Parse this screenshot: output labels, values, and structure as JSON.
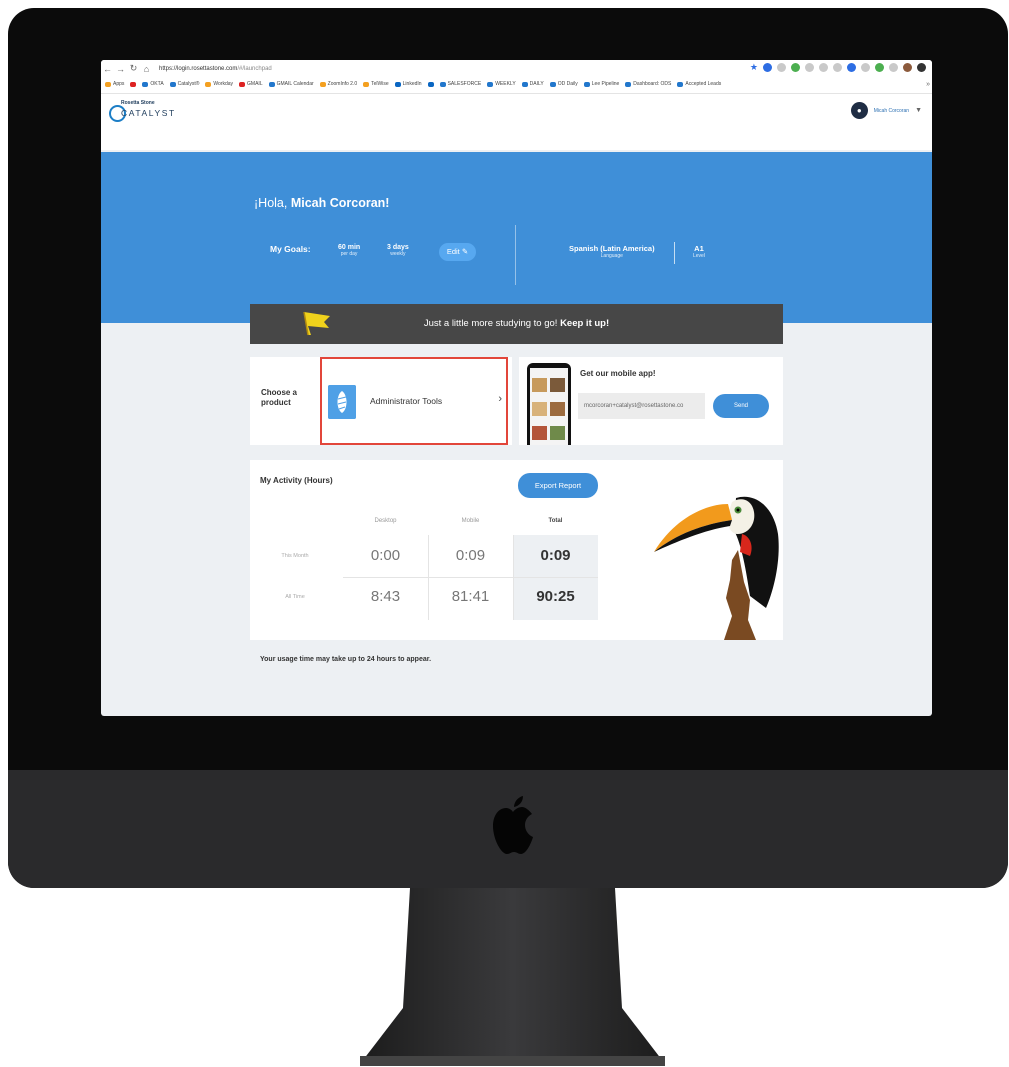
{
  "browser": {
    "url_host": "https://login.rosettastone.com",
    "url_path": "/#/launchpad",
    "bookmarks": [
      "Apps",
      "OKTA",
      "Catalyst®",
      "Workday",
      "GMAIL",
      "GMAIL Calendar",
      "ZoomInfo 2.0",
      "TelWise",
      "LinkedIn",
      "SALESFORCE",
      "WEEKLY",
      "DAILY",
      "OD Daily",
      "Lee Pipeline",
      "Dashboard: ODS",
      "Accepted Leads"
    ],
    "more": "»"
  },
  "header": {
    "brand": "Rosetta Stone",
    "product": "CATALYST",
    "user_name": "Micah Corcoran"
  },
  "hero": {
    "greeting_prefix": "¡Hola,",
    "greeting_name": "Micah Corcoran!",
    "goals_label": "My Goals:",
    "goal_minutes": "60 min",
    "goal_minutes_unit": "per day",
    "goal_days": "3 days",
    "goal_days_unit": "weekly",
    "edit_label": "Edit ✎",
    "language": "Spanish (Latin America)",
    "language_label": "Language",
    "level": "A1",
    "level_label": "Level"
  },
  "banner": {
    "text": "Just a little more studying to go! ",
    "emphasis": "Keep it up!"
  },
  "product": {
    "choose_label": "Choose a product",
    "tile_name": "Administrator Tools",
    "chevron": "›"
  },
  "mobile_app": {
    "title": "Get our mobile app!",
    "email_value": "mcorcoran+catalyst@rosettastone.co",
    "send_label": "Send"
  },
  "activity": {
    "title": "My Activity (Hours)",
    "export_label": "Export Report",
    "columns": [
      "Desktop",
      "Mobile",
      "Total"
    ],
    "rows": [
      {
        "label": "This Month",
        "desktop": "0:00",
        "mobile": "0:09",
        "total": "0:09"
      },
      {
        "label": "All Time",
        "desktop": "8:43",
        "mobile": "81:41",
        "total": "90:25"
      }
    ]
  },
  "footer_note": "Your usage time may take up to 24 hours to appear.",
  "colors": {
    "hero_blue": "#3f8fd8",
    "banner_gray": "#474747",
    "highlight_red": "#e2463a"
  }
}
